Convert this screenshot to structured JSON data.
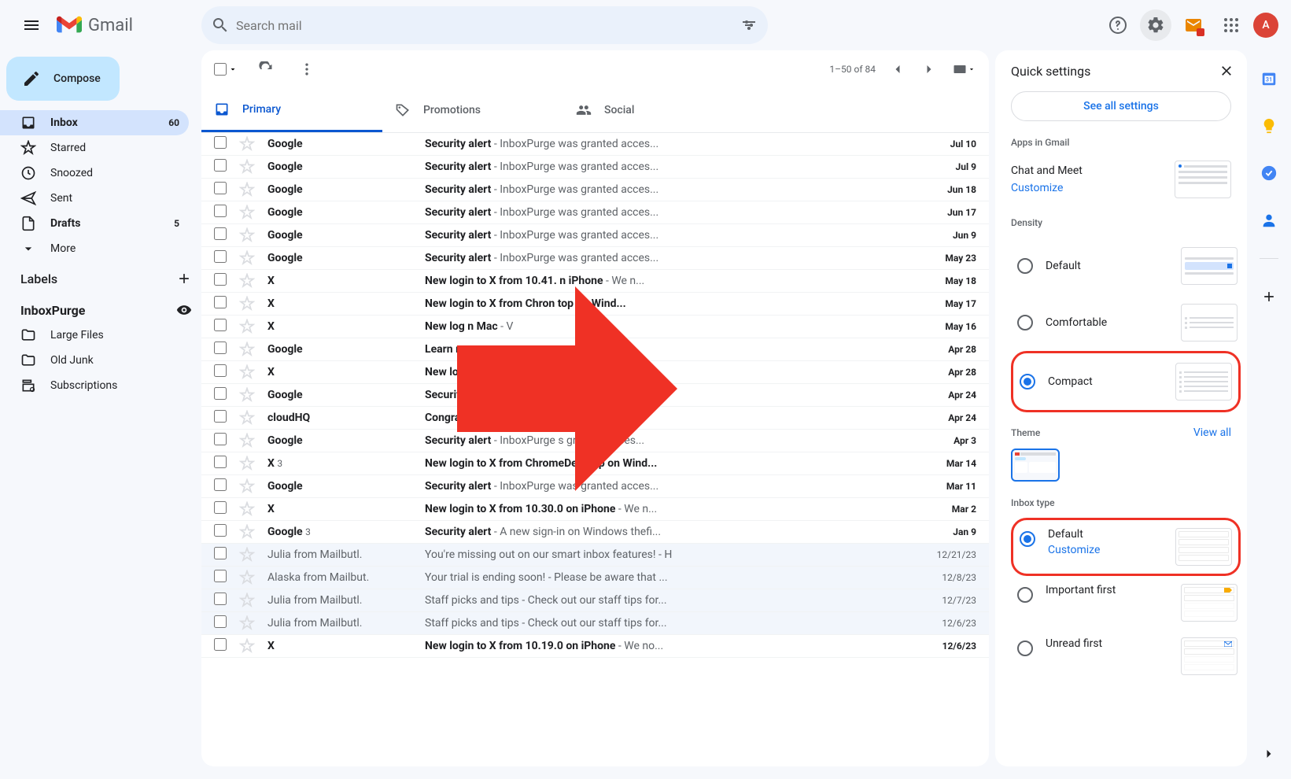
{
  "header": {
    "product": "Gmail",
    "search_placeholder": "Search mail",
    "avatar_initial": "A"
  },
  "compose_label": "Compose",
  "nav": {
    "inbox": "Inbox",
    "inbox_count": "60",
    "starred": "Starred",
    "snoozed": "Snoozed",
    "sent": "Sent",
    "drafts": "Drafts",
    "drafts_count": "5",
    "more": "More",
    "labels_header": "Labels",
    "inboxpurge": "InboxPurge",
    "large_files": "Large Files",
    "old_junk": "Old Junk",
    "subscriptions": "Subscriptions"
  },
  "toolbar": {
    "pagination": "1–50 of 84"
  },
  "tabs": {
    "primary": "Primary",
    "promotions": "Promotions",
    "social": "Social"
  },
  "emails": [
    {
      "sender": "Google",
      "subject": "Security alert",
      "snippet": " - InboxPurge was granted acces...",
      "date": "Jul 10",
      "read": false
    },
    {
      "sender": "Google",
      "subject": "Security alert",
      "snippet": " - InboxPurge was granted acces...",
      "date": "Jul 9",
      "read": false
    },
    {
      "sender": "Google",
      "subject": "Security alert",
      "snippet": " - InboxPurge was granted acces...",
      "date": "Jun 18",
      "read": false
    },
    {
      "sender": "Google",
      "subject": "Security alert",
      "snippet": " - InboxPurge was granted acces...",
      "date": "Jun 17",
      "read": false
    },
    {
      "sender": "Google",
      "subject": "Security alert",
      "snippet": " - InboxPurge was granted acces...",
      "date": "Jun 9",
      "read": false
    },
    {
      "sender": "Google",
      "subject": "Security alert",
      "snippet": " - InboxPurge was granted acces...",
      "date": "May 23",
      "read": false
    },
    {
      "sender": "X",
      "subject": "New login to X from 10.41.   n iPhone",
      "snippet": " - We n...",
      "date": "May 18",
      "read": false
    },
    {
      "sender": "X",
      "subject": "New login to X from Chron      top on Wind...",
      "snippet": "",
      "date": "May 17",
      "read": false
    },
    {
      "sender": "X",
      "subject": "New log                                   n Mac",
      "snippet": " - V",
      "date": "May 16",
      "read": false
    },
    {
      "sender": "Google",
      "subject": "Learn m                                    erv...",
      "snippet": "",
      "date": "Apr 28",
      "read": false
    },
    {
      "sender": "X",
      "subject": "New log                                   ...",
      "snippet": "",
      "date": "Apr 28",
      "read": false
    },
    {
      "sender": "Google",
      "subject": "Security                               acces...",
      "snippet": "",
      "date": "Apr 24",
      "read": false
    },
    {
      "sender": "cloudHQ",
      "subject": "Congratulations! You've su          lly installe...",
      "snippet": "",
      "date": "Apr 24",
      "read": false
    },
    {
      "sender": "Google",
      "subject": "Security alert",
      "snippet": " - InboxPurge    s granted acces...",
      "date": "Apr 3",
      "read": false
    },
    {
      "sender": "X",
      "sender_count": "3",
      "subject": "New login to X from ChromeDesktop on Wind...",
      "snippet": "",
      "date": "Mar 14",
      "read": false
    },
    {
      "sender": "Google",
      "subject": "Security alert",
      "snippet": " - InboxPurge was granted acces...",
      "date": "Mar 11",
      "read": false
    },
    {
      "sender": "X",
      "subject": "New login to X from 10.30.0 on iPhone",
      "snippet": " - We n...",
      "date": "Mar 2",
      "read": false
    },
    {
      "sender": "Google",
      "sender_count": "3",
      "subject": "Security alert",
      "snippet": " - A new sign-in on Windows thefi...",
      "date": "Jan 9",
      "read": false
    },
    {
      "sender": "Julia from Mailbutl.",
      "subject": "You're missing out on our smart inbox features!",
      "snippet": " - H",
      "date": "12/21/23",
      "read": true
    },
    {
      "sender": "Alaska from Mailbut.",
      "subject": "Your trial is ending soon!",
      "snippet": " - Please be aware that ...",
      "date": "12/8/23",
      "read": true
    },
    {
      "sender": "Julia from Mailbutl.",
      "subject": "Staff picks and tips",
      "snippet": " - Check out our staff tips for...",
      "date": "12/7/23",
      "read": true
    },
    {
      "sender": "Julia from Mailbutl.",
      "subject": "Staff picks and tips",
      "snippet": " - Check out our staff tips for...",
      "date": "12/6/23",
      "read": true
    },
    {
      "sender": "X",
      "subject": "New login to X from 10.19.0 on iPhone",
      "snippet": " - We no...",
      "date": "12/6/23",
      "read": false
    }
  ],
  "quick_settings": {
    "title": "Quick settings",
    "see_all": "See all settings",
    "apps_label": "Apps in Gmail",
    "chat_meet": "Chat and Meet",
    "customize": "Customize",
    "density_label": "Density",
    "density_default": "Default",
    "density_comfortable": "Comfortable",
    "density_compact": "Compact",
    "theme_label": "Theme",
    "view_all": "View all",
    "inbox_type_label": "Inbox type",
    "inbox_default": "Default",
    "inbox_customize": "Customize",
    "inbox_important": "Important first",
    "inbox_unread": "Unread first"
  }
}
